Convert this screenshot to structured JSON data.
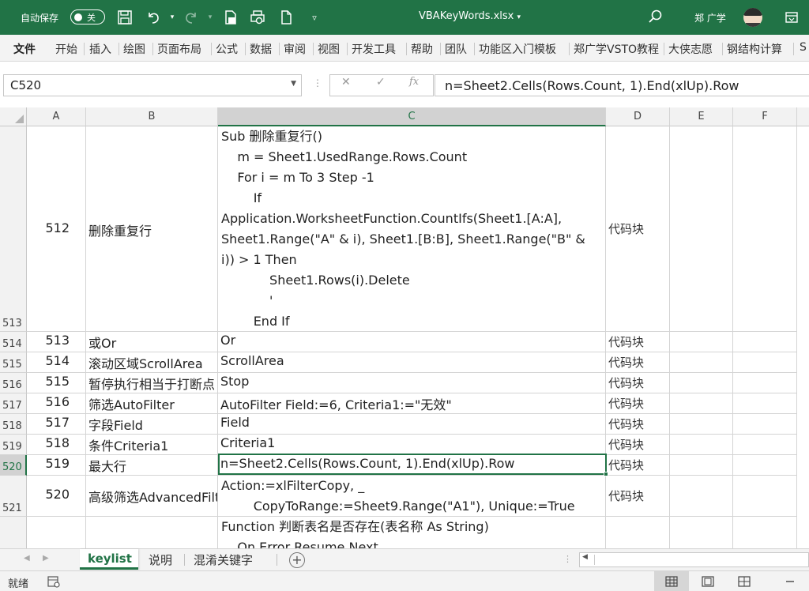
{
  "titlebar": {
    "autosave_label": "自动保存",
    "autosave_state": "关",
    "document_title": "VBAKeyWords.xlsx",
    "user_name": "郑 广学",
    "accent_color": "#217346"
  },
  "ribbon": {
    "tabs": [
      "文件",
      "开始",
      "插入",
      "绘图",
      "页面布局",
      "公式",
      "数据",
      "审阅",
      "视图",
      "开发工具",
      "帮助",
      "团队",
      "功能区入门模板",
      "郑广学VSTO教程",
      "大侠志愿",
      "钢结构计算",
      "S"
    ]
  },
  "formula_bar": {
    "name_box": "C520",
    "formula": "n=Sheet2.Cells(Rows.Count, 1).End(xlUp).Row"
  },
  "columns": [
    "A",
    "B",
    "C",
    "D",
    "E",
    "F"
  ],
  "selected_column": "C",
  "rows": [
    {
      "row": "513",
      "a": "512",
      "b": "删除重复行",
      "c": "Sub 删除重复行()\n    m = Sheet1.UsedRange.Rows.Count\n    For i = m To 3 Step -1\n        If\nApplication.WorksheetFunction.CountIfs(Sheet1.[A:A],\nSheet1.Range(\"A\" & i), Sheet1.[B:B], Sheet1.Range(\"B\" &\ni)) > 1 Then\n            Sheet1.Rows(i).Delete\n            '\n        End If",
      "d": "代码块"
    },
    {
      "row": "514",
      "a": "513",
      "b": "或Or",
      "c": "Or",
      "d": "代码块"
    },
    {
      "row": "515",
      "a": "514",
      "b": "滚动区域ScrollArea",
      "c": "ScrollArea",
      "d": "代码块"
    },
    {
      "row": "516",
      "a": "515",
      "b": "暂停执行相当于打断点",
      "c": "Stop",
      "d": "代码块"
    },
    {
      "row": "517",
      "a": "516",
      "b": "筛选AutoFilter",
      "c": "AutoFilter Field:=6, Criteria1:=\"无效\"",
      "d": "代码块"
    },
    {
      "row": "518",
      "a": "517",
      "b": "字段Field",
      "c": "Field",
      "d": "代码块"
    },
    {
      "row": "519",
      "a": "518",
      "b": "条件Criteria1",
      "c": "Criteria1",
      "d": "代码块"
    },
    {
      "row": "520",
      "a": "519",
      "b": "最大行",
      "c": "n=Sheet2.Cells(Rows.Count, 1).End(xlUp).Row",
      "d": "代码块"
    },
    {
      "row": "521",
      "a": "520",
      "b": "高级筛选AdvancedFilter",
      "c": "Action:=xlFilterCopy, _\n        CopyToRange:=Sheet9.Range(\"A1\"), Unique:=True",
      "d": "代码块"
    },
    {
      "row": "",
      "a": "",
      "b": "",
      "c": "Function 判断表名是否存在(表名称 As String)\n    On Error Resume Next",
      "d": ""
    }
  ],
  "selected_row": "520",
  "sheets": [
    "keylist",
    "说明",
    "混淆关键字"
  ],
  "active_sheet": "keylist",
  "status": {
    "ready": "就绪"
  }
}
